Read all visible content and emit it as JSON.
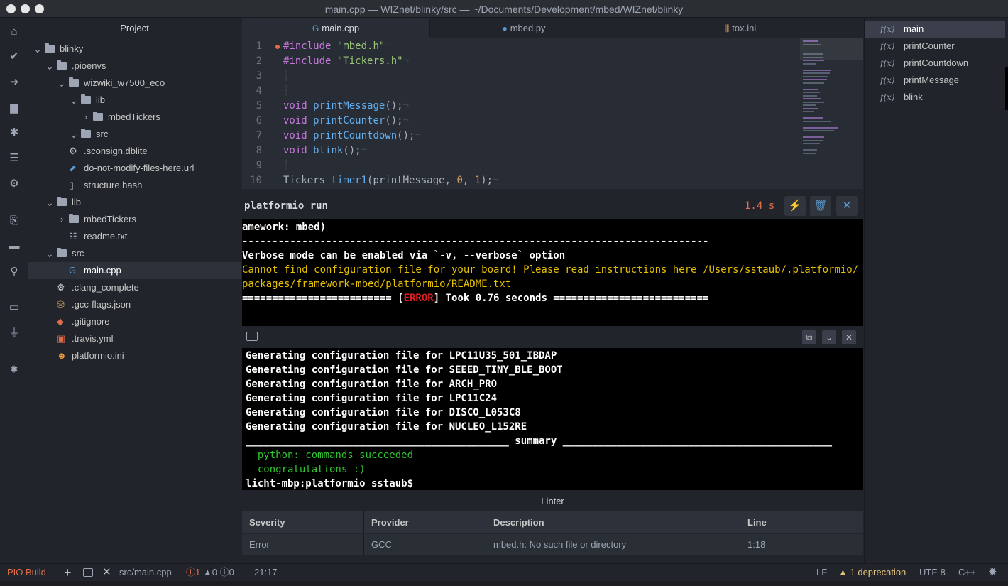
{
  "window": {
    "title": "main.cpp — WIZnet/blinky/src — ~/Documents/Development/mbed/WIZnet/blinky"
  },
  "activity_icons": [
    "home-icon",
    "check-icon",
    "arrow-right-icon",
    "trash-icon",
    "bug-icon",
    "checklist-icon",
    "device-icon",
    "code-file-icon",
    "folder-icon",
    "search-icon",
    "terminal-icon",
    "plug-icon",
    "gear-icon"
  ],
  "tree": {
    "title": "Project",
    "items": [
      {
        "label": "blinky",
        "kind": "folder",
        "expanded": true
      },
      {
        "label": ".pioenvs",
        "kind": "folder",
        "expanded": true
      },
      {
        "label": "wizwiki_w7500_eco",
        "kind": "folder",
        "expanded": true
      },
      {
        "label": "lib",
        "kind": "folder",
        "expanded": true
      },
      {
        "label": "mbedTickers",
        "kind": "folder",
        "expanded": false
      },
      {
        "label": "src",
        "kind": "folder",
        "expanded": true
      },
      {
        "label": ".sconsign.dblite",
        "kind": "gear"
      },
      {
        "label": "do-not-modify-files-here.url",
        "kind": "link"
      },
      {
        "label": "structure.hash",
        "kind": "file"
      },
      {
        "label": "lib",
        "kind": "folder",
        "expanded": true
      },
      {
        "label": "mbedTickers",
        "kind": "folder",
        "expanded": false
      },
      {
        "label": "readme.txt",
        "kind": "text"
      },
      {
        "label": "src",
        "kind": "folder",
        "expanded": true
      },
      {
        "label": "main.cpp",
        "kind": "cpp",
        "selected": true
      },
      {
        "label": ".clang_complete",
        "kind": "gear"
      },
      {
        "label": ".gcc-flags.json",
        "kind": "db"
      },
      {
        "label": ".gitignore",
        "kind": "git"
      },
      {
        "label": ".travis.yml",
        "kind": "travis"
      },
      {
        "label": "platformio.ini",
        "kind": "pio"
      }
    ]
  },
  "tabs": [
    {
      "label": "main.cpp",
      "active": true
    },
    {
      "label": "mbed.py",
      "active": false
    },
    {
      "label": "tox.ini",
      "active": false
    }
  ],
  "code": {
    "line_numbers": [
      "1",
      "2",
      "3",
      "4",
      "5",
      "6",
      "7",
      "8",
      "9",
      "10"
    ],
    "lines": [
      "#include \"mbed.h\"¬",
      "#include \"Tickers.h\"¬",
      "┆",
      "┆",
      "void printMessage();¬",
      "void printCounter();¬",
      "void printCountdown();¬",
      "void blink();¬",
      "┆",
      "Tickers timer1(printMessage, 0, 1);¬"
    ]
  },
  "outline": {
    "fx_label": "f(x)",
    "items": [
      {
        "label": "main",
        "selected": true
      },
      {
        "label": "printCounter",
        "selected": false
      },
      {
        "label": "printCountdown",
        "selected": false
      },
      {
        "label": "printMessage",
        "selected": false
      },
      {
        "label": "blink",
        "selected": false
      }
    ]
  },
  "build": {
    "title": "platformio run",
    "time": "1.4 s",
    "lines": [
      "amework: mbed)",
      "------------------------------------------------------------------------------",
      "Verbose mode can be enabled via `-v, --verbose` option",
      "Cannot find configuration file for your board! Please read instructions here /Users/sstaub/.platformio/",
      "packages/framework-mbed/platformio/README.txt",
      "========================= [",
      "ERROR",
      "] Took 0.76 seconds =========================="
    ]
  },
  "terminal": {
    "lines": [
      "Generating configuration file for LPC11U35_501_IBDAP",
      "Generating configuration file for SEEED_TINY_BLE_BOOT",
      "Generating configuration file for ARCH_PRO",
      "Generating configuration file for LPC11C24",
      "Generating configuration file for DISCO_L053C8",
      "Generating configuration file for NUCLEO_L152RE",
      "____________________________________________ summary _____________________________________________",
      "  python: commands succeeded",
      "  congratulations :)",
      "licht-mbp:platformio sstaub$"
    ]
  },
  "linter": {
    "title": "Linter",
    "columns": [
      "Severity",
      "Provider",
      "Description",
      "Line"
    ],
    "rows": [
      [
        "Error",
        "GCC",
        "mbed.h: No such file or directory",
        "1:18"
      ]
    ]
  },
  "status": {
    "pio_build": "PIO Build",
    "file": "src/main.cpp",
    "errors": "1",
    "warnings": "0",
    "infos": "0",
    "cursor": "21:17",
    "eol": "LF",
    "deprecation": "1 deprecation",
    "encoding": "UTF-8",
    "grammar": "C++"
  },
  "colors": {
    "accent_red": "#e06c4a",
    "keyword": "#c678dd",
    "string": "#98c379",
    "function": "#61afef",
    "number": "#d19a66",
    "term_yellow": "#e5c100",
    "term_green": "#2ec52e"
  }
}
